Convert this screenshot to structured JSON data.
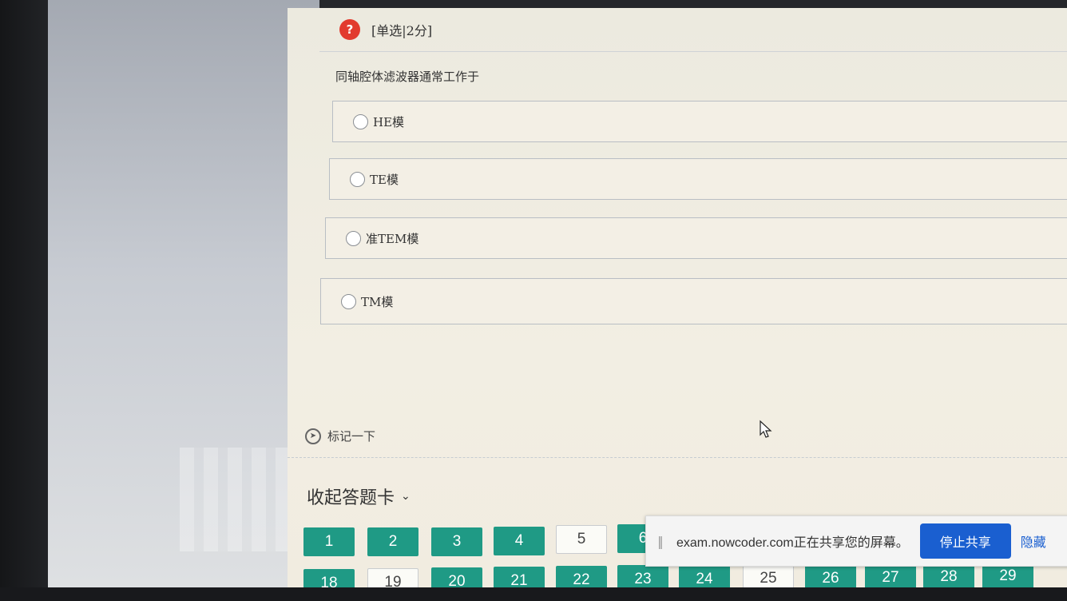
{
  "question": {
    "type_label": "[单选|2分]",
    "help_icon": "question-circle-icon",
    "text": "同轴腔体滤波器通常工作于",
    "options": [
      "HE模",
      "TE模",
      "准TEM模",
      "TM模"
    ]
  },
  "mark": {
    "label": "标记一下",
    "icon": "compass-icon"
  },
  "answer_card": {
    "collapse_label": "收起答题卡",
    "row1": [
      {
        "n": "1",
        "answered": true
      },
      {
        "n": "2",
        "answered": true
      },
      {
        "n": "3",
        "answered": true
      },
      {
        "n": "4",
        "answered": true
      },
      {
        "n": "5",
        "answered": false
      },
      {
        "n": "6",
        "answered": true
      }
    ],
    "row2": [
      {
        "n": "18",
        "answered": true
      },
      {
        "n": "19",
        "answered": false
      },
      {
        "n": "20",
        "answered": true
      },
      {
        "n": "21",
        "answered": true
      },
      {
        "n": "22",
        "answered": true
      },
      {
        "n": "23",
        "answered": true
      },
      {
        "n": "24",
        "answered": true
      },
      {
        "n": "25",
        "answered": false
      },
      {
        "n": "26",
        "answered": true
      },
      {
        "n": "27",
        "answered": true
      },
      {
        "n": "28",
        "answered": true
      },
      {
        "n": "29",
        "answered": true
      }
    ]
  },
  "share_bar": {
    "message": "exam.nowcoder.com正在共享您的屏幕。",
    "stop_label": "停止共享",
    "hide_label": "隐藏"
  },
  "colors": {
    "answered": "#1f9a85",
    "accent_blue": "#1a5fd0",
    "help_red": "#e23b2e"
  }
}
